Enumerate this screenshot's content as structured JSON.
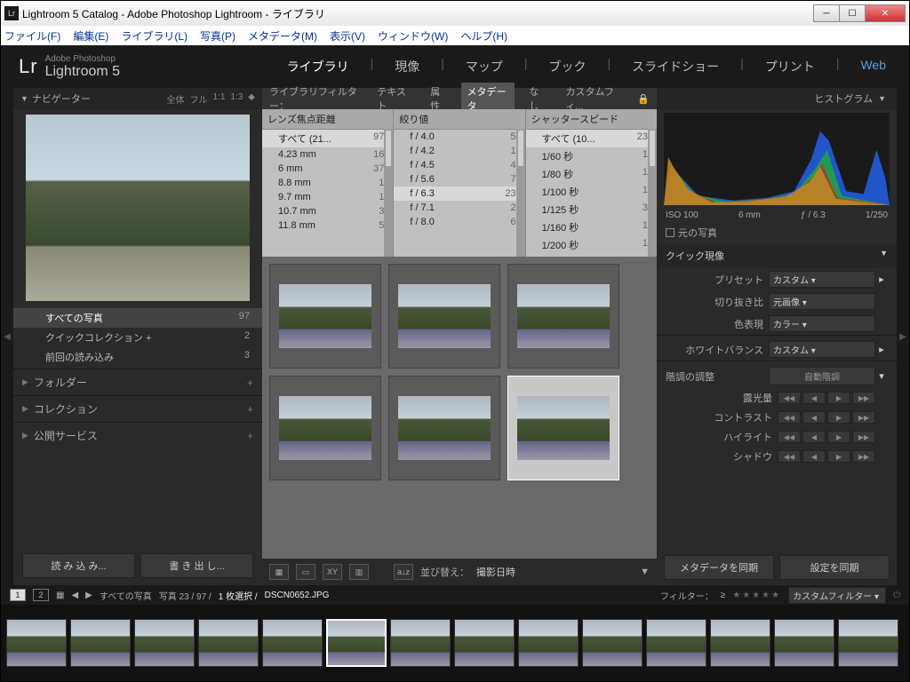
{
  "window": {
    "title": "Lightroom 5 Catalog - Adobe Photoshop Lightroom - ライブラリ"
  },
  "menu": {
    "file": "ファイル(F)",
    "edit": "編集(E)",
    "library": "ライブラリ(L)",
    "photo": "写真(P)",
    "metadata": "メタデータ(M)",
    "view": "表示(V)",
    "window": "ウィンドウ(W)",
    "help": "ヘルプ(H)"
  },
  "logo": {
    "sub": "Adobe Photoshop",
    "main": "Lightroom 5"
  },
  "modules": {
    "library": "ライブラリ",
    "develop": "現像",
    "map": "マップ",
    "book": "ブック",
    "slideshow": "スライドショー",
    "print": "プリント",
    "web": "Web"
  },
  "navigator": {
    "title": "ナビゲーター",
    "fit": "全体",
    "fill": "フル",
    "r1": "1:1",
    "r2": "1:3"
  },
  "catalog": {
    "all": {
      "label": "すべての写真",
      "count": "97"
    },
    "quick": {
      "label": "クイックコレクション  +",
      "count": "2"
    },
    "prev": {
      "label": "前回の読み込み",
      "count": "3"
    }
  },
  "sections": {
    "folders": "フォルダー",
    "collections": "コレクション",
    "publish": "公開サービス"
  },
  "leftbtns": {
    "import": "読 み 込 み...",
    "export": "書 き 出 し..."
  },
  "filterbar": {
    "label": "ライブラリフィルター：",
    "text": "テキスト",
    "attr": "属性",
    "meta": "メタデータ",
    "none": "なし",
    "custom": "カスタムフィ..."
  },
  "metacols": {
    "focal": {
      "title": "レンズ焦点距離",
      "rows": [
        {
          "k": "すべて (21...",
          "v": "97",
          "sel": true
        },
        {
          "k": "4.23 mm",
          "v": "16"
        },
        {
          "k": "6 mm",
          "v": "37"
        },
        {
          "k": "8.8 mm",
          "v": "1"
        },
        {
          "k": "9.7 mm",
          "v": "1"
        },
        {
          "k": "10.7 mm",
          "v": "3"
        },
        {
          "k": "11.8 mm",
          "v": "5"
        }
      ]
    },
    "aperture": {
      "title": "絞り値",
      "rows": [
        {
          "k": "f / 4.0",
          "v": "5"
        },
        {
          "k": "f / 4.2",
          "v": "1"
        },
        {
          "k": "f / 4.5",
          "v": "4"
        },
        {
          "k": "f / 5.6",
          "v": "7"
        },
        {
          "k": "f / 6.3",
          "v": "23",
          "sel": true
        },
        {
          "k": "f / 7.1",
          "v": "2"
        },
        {
          "k": "f / 8.0",
          "v": "6"
        }
      ]
    },
    "shutter": {
      "title": "シャッタースピード",
      "rows": [
        {
          "k": "すべて (10...",
          "v": "23",
          "sel": true
        },
        {
          "k": "1/60 秒",
          "v": "1"
        },
        {
          "k": "1/80 秒",
          "v": "1"
        },
        {
          "k": "1/100 秒",
          "v": "1"
        },
        {
          "k": "1/125 秒",
          "v": "3"
        },
        {
          "k": "1/160 秒",
          "v": "1"
        },
        {
          "k": "1/200 秒",
          "v": "1"
        }
      ]
    }
  },
  "toolbar": {
    "sort": "並び替え：",
    "sortval": "撮影日時"
  },
  "histogram": {
    "title": "ヒストグラム",
    "iso": "ISO 100",
    "focal": "6 mm",
    "f": "ƒ / 6.3",
    "sh": "1/250",
    "orig": "元の写真"
  },
  "quick": {
    "title": "クイック現像",
    "preset_l": "プリセット",
    "preset_v": "カスタム",
    "crop_l": "切り抜き比",
    "crop_v": "元画像",
    "treat_l": "色表現",
    "treat_v": "カラー",
    "wb_l": "ホワイトバランス",
    "wb_v": "カスタム",
    "tone_l": "階調の調整",
    "tone_btn": "自動階調",
    "expo": "露光量",
    "contrast": "コントラスト",
    "highlight": "ハイライト",
    "shadow": "シャドウ"
  },
  "rbtns": {
    "syncmeta": "メタデータを同期",
    "syncset": "設定を同期"
  },
  "status": {
    "coll": "すべての写真",
    "count": "写真 23 / 97 /",
    "sel": "1 枚選択 /",
    "file": "DSCN0652.JPG",
    "filter": "フィルター：",
    "custom": "カスタムフィルター"
  }
}
